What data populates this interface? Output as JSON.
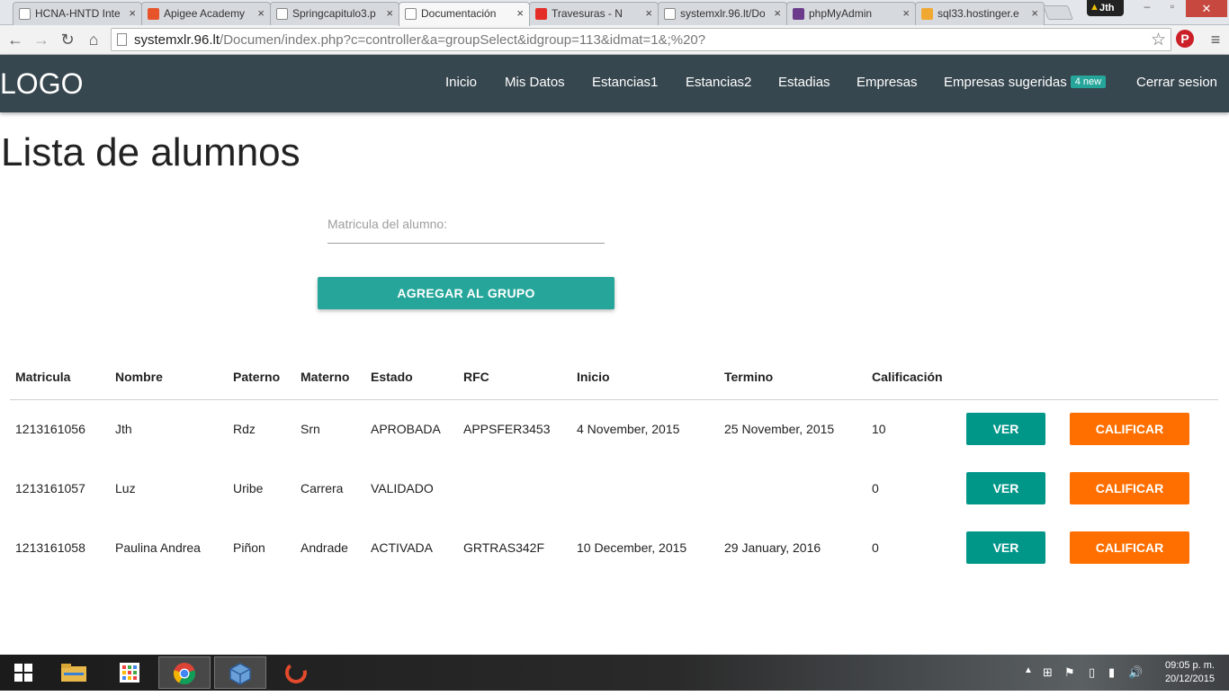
{
  "browser": {
    "tabs": [
      {
        "label": "HCNA-HNTD Inte",
        "close": "×"
      },
      {
        "label": "Apigee Academy",
        "close": "×"
      },
      {
        "label": "Springcapitulo3.p",
        "close": "×"
      },
      {
        "label": "Documentación",
        "close": "×"
      },
      {
        "label": "Travesuras - N",
        "close": "×"
      },
      {
        "label": "systemxlr.96.lt/Do",
        "close": "×"
      },
      {
        "label": "phpMyAdmin",
        "close": "×"
      },
      {
        "label": "sql33.hostinger.e",
        "close": "×"
      }
    ],
    "profile_name": "Jth",
    "url_host": "systemxlr.96.lt",
    "url_path": "/Documen/index.php?c=controller&a=groupSelect&idgroup=113&idmat=1&;%20?"
  },
  "nav": {
    "logo": "LOGO",
    "items": [
      "Inicio",
      "Mis Datos",
      "Estancias1",
      "Estancias2",
      "Estadias",
      "Empresas",
      "Empresas sugeridas",
      "Cerrar sesion"
    ],
    "badge": "4 new"
  },
  "page": {
    "title": "Lista de alumnos",
    "matricula_placeholder": "Matricula del alumno:",
    "add_button": "AGREGAR AL GRUPO"
  },
  "table": {
    "headers": [
      "Matricula",
      "Nombre",
      "Paterno",
      "Materno",
      "Estado",
      "RFC",
      "Inicio",
      "Termino",
      "Calificación"
    ],
    "view_label": "VER",
    "grade_label": "CALIFICAR",
    "rows": [
      {
        "matricula": "1213161056",
        "nombre": "Jth",
        "paterno": "Rdz",
        "materno": "Srn",
        "estado": "APROBADA",
        "rfc": "APPSFER3453",
        "inicio": "4 November, 2015",
        "termino": "25 November, 2015",
        "calificacion": "10"
      },
      {
        "matricula": "1213161057",
        "nombre": "Luz",
        "paterno": "Uribe",
        "materno": "Carrera",
        "estado": "VALIDADO",
        "rfc": "",
        "inicio": "",
        "termino": "",
        "calificacion": "0"
      },
      {
        "matricula": "1213161058",
        "nombre": "Paulina Andrea",
        "paterno": "Piñon",
        "materno": "Andrade",
        "estado": "ACTIVADA",
        "rfc": "GRTRAS342F",
        "inicio": "10 December, 2015",
        "termino": "29 January, 2016",
        "calificacion": "0"
      }
    ]
  },
  "taskbar": {
    "time": "09:05 p. m.",
    "date": "20/12/2015"
  },
  "colors": {
    "nav_bg": "#37474f",
    "teal": "#26a69a",
    "teal_dark": "#009688",
    "orange": "#ff6f00"
  }
}
